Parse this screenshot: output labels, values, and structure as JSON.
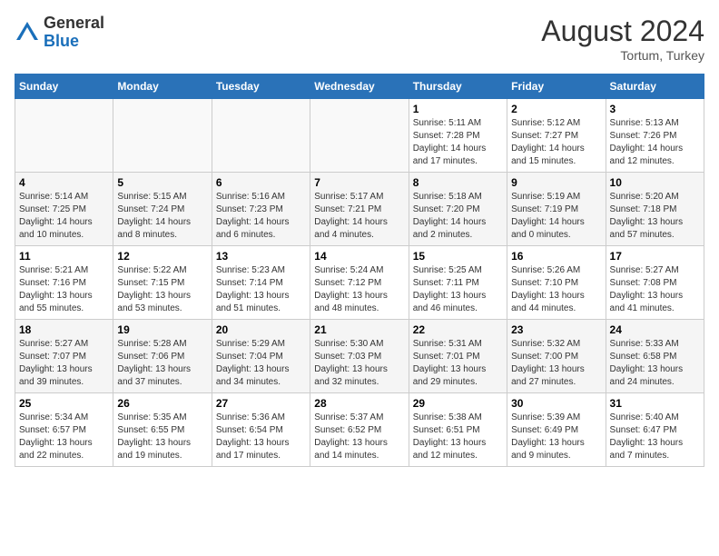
{
  "header": {
    "logo_general": "General",
    "logo_blue": "Blue",
    "month_year": "August 2024",
    "location": "Tortum, Turkey"
  },
  "days_of_week": [
    "Sunday",
    "Monday",
    "Tuesday",
    "Wednesday",
    "Thursday",
    "Friday",
    "Saturday"
  ],
  "weeks": [
    [
      {
        "day": "",
        "info": ""
      },
      {
        "day": "",
        "info": ""
      },
      {
        "day": "",
        "info": ""
      },
      {
        "day": "",
        "info": ""
      },
      {
        "day": "1",
        "info": "Sunrise: 5:11 AM\nSunset: 7:28 PM\nDaylight: 14 hours and 17 minutes."
      },
      {
        "day": "2",
        "info": "Sunrise: 5:12 AM\nSunset: 7:27 PM\nDaylight: 14 hours and 15 minutes."
      },
      {
        "day": "3",
        "info": "Sunrise: 5:13 AM\nSunset: 7:26 PM\nDaylight: 14 hours and 12 minutes."
      }
    ],
    [
      {
        "day": "4",
        "info": "Sunrise: 5:14 AM\nSunset: 7:25 PM\nDaylight: 14 hours and 10 minutes."
      },
      {
        "day": "5",
        "info": "Sunrise: 5:15 AM\nSunset: 7:24 PM\nDaylight: 14 hours and 8 minutes."
      },
      {
        "day": "6",
        "info": "Sunrise: 5:16 AM\nSunset: 7:23 PM\nDaylight: 14 hours and 6 minutes."
      },
      {
        "day": "7",
        "info": "Sunrise: 5:17 AM\nSunset: 7:21 PM\nDaylight: 14 hours and 4 minutes."
      },
      {
        "day": "8",
        "info": "Sunrise: 5:18 AM\nSunset: 7:20 PM\nDaylight: 14 hours and 2 minutes."
      },
      {
        "day": "9",
        "info": "Sunrise: 5:19 AM\nSunset: 7:19 PM\nDaylight: 14 hours and 0 minutes."
      },
      {
        "day": "10",
        "info": "Sunrise: 5:20 AM\nSunset: 7:18 PM\nDaylight: 13 hours and 57 minutes."
      }
    ],
    [
      {
        "day": "11",
        "info": "Sunrise: 5:21 AM\nSunset: 7:16 PM\nDaylight: 13 hours and 55 minutes."
      },
      {
        "day": "12",
        "info": "Sunrise: 5:22 AM\nSunset: 7:15 PM\nDaylight: 13 hours and 53 minutes."
      },
      {
        "day": "13",
        "info": "Sunrise: 5:23 AM\nSunset: 7:14 PM\nDaylight: 13 hours and 51 minutes."
      },
      {
        "day": "14",
        "info": "Sunrise: 5:24 AM\nSunset: 7:12 PM\nDaylight: 13 hours and 48 minutes."
      },
      {
        "day": "15",
        "info": "Sunrise: 5:25 AM\nSunset: 7:11 PM\nDaylight: 13 hours and 46 minutes."
      },
      {
        "day": "16",
        "info": "Sunrise: 5:26 AM\nSunset: 7:10 PM\nDaylight: 13 hours and 44 minutes."
      },
      {
        "day": "17",
        "info": "Sunrise: 5:27 AM\nSunset: 7:08 PM\nDaylight: 13 hours and 41 minutes."
      }
    ],
    [
      {
        "day": "18",
        "info": "Sunrise: 5:27 AM\nSunset: 7:07 PM\nDaylight: 13 hours and 39 minutes."
      },
      {
        "day": "19",
        "info": "Sunrise: 5:28 AM\nSunset: 7:06 PM\nDaylight: 13 hours and 37 minutes."
      },
      {
        "day": "20",
        "info": "Sunrise: 5:29 AM\nSunset: 7:04 PM\nDaylight: 13 hours and 34 minutes."
      },
      {
        "day": "21",
        "info": "Sunrise: 5:30 AM\nSunset: 7:03 PM\nDaylight: 13 hours and 32 minutes."
      },
      {
        "day": "22",
        "info": "Sunrise: 5:31 AM\nSunset: 7:01 PM\nDaylight: 13 hours and 29 minutes."
      },
      {
        "day": "23",
        "info": "Sunrise: 5:32 AM\nSunset: 7:00 PM\nDaylight: 13 hours and 27 minutes."
      },
      {
        "day": "24",
        "info": "Sunrise: 5:33 AM\nSunset: 6:58 PM\nDaylight: 13 hours and 24 minutes."
      }
    ],
    [
      {
        "day": "25",
        "info": "Sunrise: 5:34 AM\nSunset: 6:57 PM\nDaylight: 13 hours and 22 minutes."
      },
      {
        "day": "26",
        "info": "Sunrise: 5:35 AM\nSunset: 6:55 PM\nDaylight: 13 hours and 19 minutes."
      },
      {
        "day": "27",
        "info": "Sunrise: 5:36 AM\nSunset: 6:54 PM\nDaylight: 13 hours and 17 minutes."
      },
      {
        "day": "28",
        "info": "Sunrise: 5:37 AM\nSunset: 6:52 PM\nDaylight: 13 hours and 14 minutes."
      },
      {
        "day": "29",
        "info": "Sunrise: 5:38 AM\nSunset: 6:51 PM\nDaylight: 13 hours and 12 minutes."
      },
      {
        "day": "30",
        "info": "Sunrise: 5:39 AM\nSunset: 6:49 PM\nDaylight: 13 hours and 9 minutes."
      },
      {
        "day": "31",
        "info": "Sunrise: 5:40 AM\nSunset: 6:47 PM\nDaylight: 13 hours and 7 minutes."
      }
    ]
  ]
}
